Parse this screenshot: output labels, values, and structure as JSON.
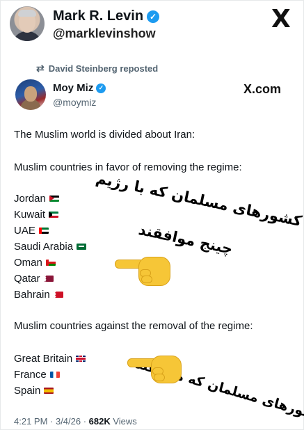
{
  "outer": {
    "name": "Mark R. Levin",
    "handle": "@marklevinshow",
    "x_logo": "X"
  },
  "repost": {
    "text": "David Steinberg reposted"
  },
  "inner": {
    "name": "Moy Miz",
    "handle": "@moymiz",
    "brand": "X.com"
  },
  "post": {
    "line1": "The Muslim world is divided about Iran:",
    "favor_heading": "Muslim countries in favor of removing the regime:",
    "favor_countries": [
      {
        "name": "Jordan",
        "flag": "jordan"
      },
      {
        "name": "Kuwait",
        "flag": "kuwait"
      },
      {
        "name": "UAE",
        "flag": "uae"
      },
      {
        "name": "Saudi Arabia",
        "flag": "saudi"
      },
      {
        "name": "Oman",
        "flag": "oman"
      },
      {
        "name": "Qatar",
        "flag": "qatar"
      },
      {
        "name": "Bahrain",
        "flag": "bahrain"
      }
    ],
    "against_heading": "Muslim countries against the removal of the regime:",
    "against_countries": [
      {
        "name": "Great Britain",
        "flag": "uk"
      },
      {
        "name": "France",
        "flag": "france"
      },
      {
        "name": "Spain",
        "flag": "spain"
      }
    ]
  },
  "overlay": {
    "favor_line1": "کشورهای مسلمان که با رژیم",
    "favor_line2": "چینج موافقند",
    "against_line": "کشورهای مسلمان که مخالفند"
  },
  "footer": {
    "time": "4:21 PM · 3/4/26 · ",
    "views_count": "682K",
    "views_label": " Views"
  }
}
